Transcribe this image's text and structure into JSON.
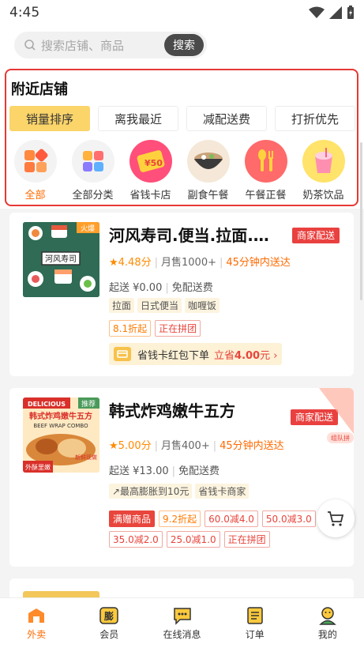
{
  "status_bar": {
    "time": "4:45"
  },
  "search": {
    "placeholder": "搜索店铺、商品",
    "button": "搜索"
  },
  "nearby": {
    "title": "附近店铺",
    "sort_tabs": [
      {
        "label": "销量排序",
        "active": true
      },
      {
        "label": "离我最近"
      },
      {
        "label": "减配送费"
      },
      {
        "label": "打折优先"
      }
    ],
    "categories": [
      {
        "label": "全部",
        "icon": "all-grid-icon",
        "active": true
      },
      {
        "label": "全部分类",
        "icon": "categories-icon"
      },
      {
        "label": "省钱卡店",
        "icon": "money-card-icon",
        "badge": "¥50"
      },
      {
        "label": "副食午餐",
        "icon": "hotpot-bowl-icon"
      },
      {
        "label": "午餐正餐",
        "icon": "spoon-fork-icon"
      },
      {
        "label": "奶茶饮品",
        "icon": "drink-cup-icon"
      }
    ]
  },
  "shops": [
    {
      "name": "河风寿司.便当.拉面.…",
      "thumb_label": "河风寿司",
      "thumb_badge": "火爆",
      "delivery": "商家配送",
      "rating": "4.48分",
      "sales": "月售1000+",
      "eta": "45分钟内送达",
      "min_order": "起送 ¥0.00",
      "delivery_fee": "免配送费",
      "tags": [
        "拉面",
        "日式便当",
        "咖喱饭"
      ],
      "promos": [
        "8.1折起",
        "正在拼团"
      ],
      "coupon_text": "省钱卡红包下单",
      "coupon_prefix": "立省",
      "coupon_amount": "4.00",
      "coupon_suffix": "元"
    },
    {
      "name": "韩式炸鸡嫩牛五方",
      "thumb_badge": "推荐",
      "thumb_title": "DELICIOUS",
      "thumb_sub": "韩式炸鸡嫩牛五方",
      "thumb_en": "BEEF WRAP COMBO",
      "thumb_tag": "外酥里嫩",
      "thumb_tag2": "新鲜现做",
      "corner_tag": "组队拼",
      "delivery": "商家配送",
      "rating": "5.00分",
      "sales": "月售400+",
      "eta": "45分钟内送达",
      "min_order": "起送 ¥13.00",
      "delivery_fee": "免配送费",
      "tags": [
        "↗最高膨胀到10元",
        "省钱卡商家"
      ],
      "promos": [
        "满赠商品",
        "9.2折起",
        "60.0减4.0",
        "50.0减3.0",
        "35.0减2.0",
        "25.0减1.0",
        "正在拼团"
      ]
    }
  ],
  "tabbar": [
    {
      "label": "外卖",
      "icon": "takeaway-icon",
      "active": true
    },
    {
      "label": "会员",
      "icon": "member-icon"
    },
    {
      "label": "在线消息",
      "icon": "message-icon"
    },
    {
      "label": "订单",
      "icon": "order-icon"
    },
    {
      "label": "我的",
      "icon": "profile-icon"
    }
  ],
  "colors": {
    "accent": "#ff6a00",
    "red": "#e9413f",
    "yellow": "#fbd46a"
  }
}
